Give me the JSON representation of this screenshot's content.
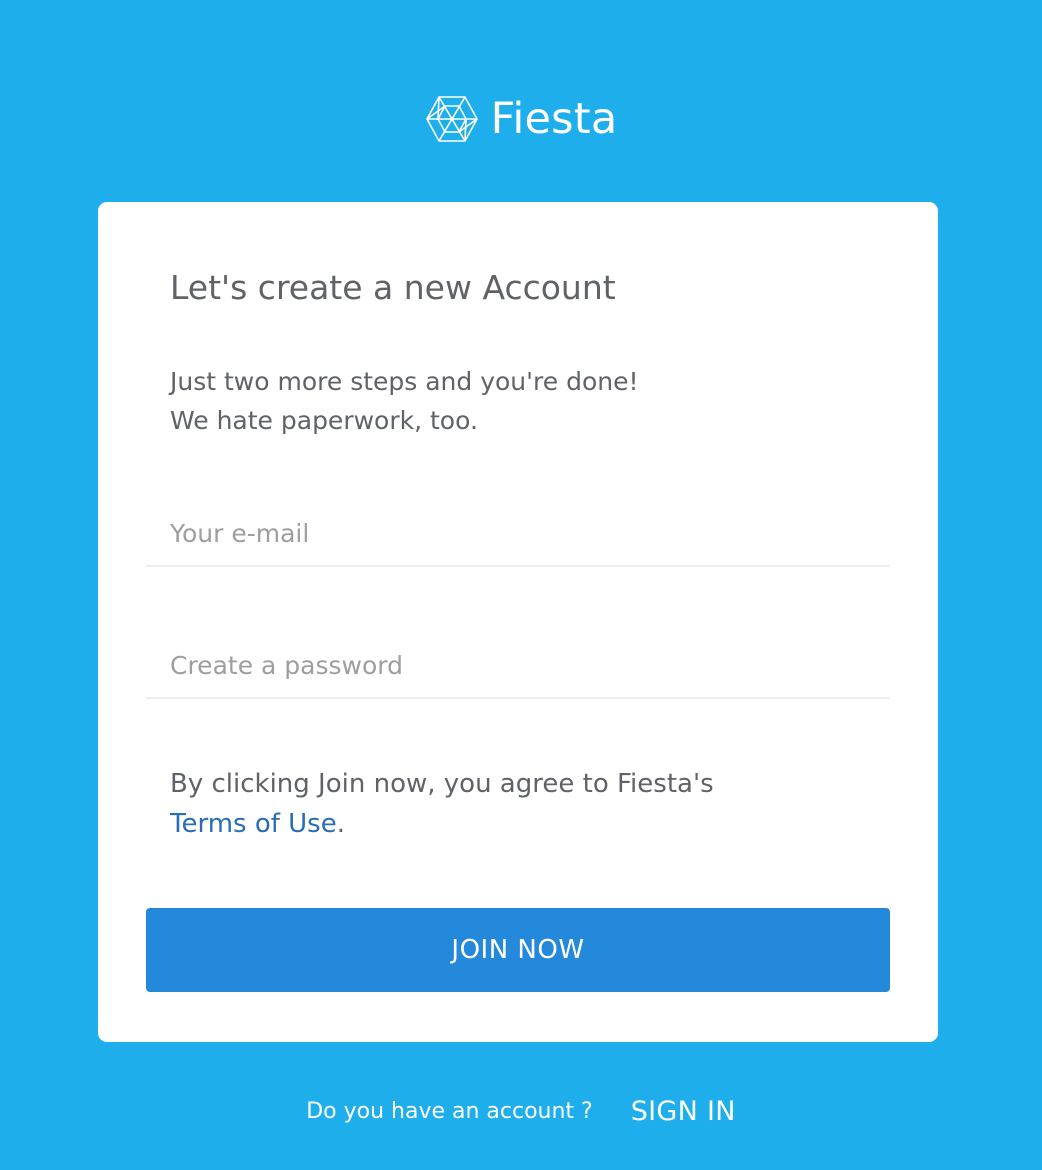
{
  "brand": {
    "name": "Fiesta",
    "logo_icon": "geodesic-hexagon-icon"
  },
  "form": {
    "heading": "Let's create a new Account",
    "intro_line1": "Just two more steps and you're done!",
    "intro_line2": "We hate paperwork, too.",
    "email": {
      "value": "",
      "placeholder": "Your e-mail"
    },
    "password": {
      "value": "",
      "placeholder": "Create a password"
    },
    "terms_prefix": "By clicking Join now, you agree to Fiesta's",
    "terms_link": "Terms of Use",
    "terms_suffix": ".",
    "submit_label": "JOIN NOW"
  },
  "footer": {
    "question": "Do you have an account ?",
    "signin_label": "SIGN IN"
  },
  "colors": {
    "background": "#1eaeec",
    "card": "#ffffff",
    "button": "#2589db",
    "link": "#2a6db5",
    "text": "#5f6368",
    "placeholder": "#9e9e9e"
  }
}
